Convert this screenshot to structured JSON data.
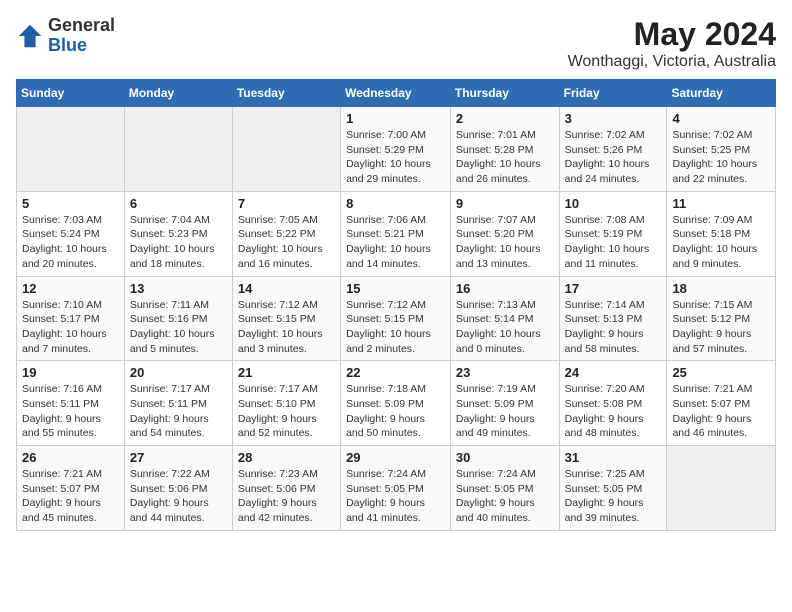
{
  "logo": {
    "general": "General",
    "blue": "Blue"
  },
  "title": "May 2024",
  "subtitle": "Wonthaggi, Victoria, Australia",
  "days_of_week": [
    "Sunday",
    "Monday",
    "Tuesday",
    "Wednesday",
    "Thursday",
    "Friday",
    "Saturday"
  ],
  "weeks": [
    [
      {
        "date": "",
        "sunrise": "",
        "sunset": "",
        "daylight": ""
      },
      {
        "date": "",
        "sunrise": "",
        "sunset": "",
        "daylight": ""
      },
      {
        "date": "",
        "sunrise": "",
        "sunset": "",
        "daylight": ""
      },
      {
        "date": "1",
        "sunrise": "Sunrise: 7:00 AM",
        "sunset": "Sunset: 5:29 PM",
        "daylight": "Daylight: 10 hours and 29 minutes."
      },
      {
        "date": "2",
        "sunrise": "Sunrise: 7:01 AM",
        "sunset": "Sunset: 5:28 PM",
        "daylight": "Daylight: 10 hours and 26 minutes."
      },
      {
        "date": "3",
        "sunrise": "Sunrise: 7:02 AM",
        "sunset": "Sunset: 5:26 PM",
        "daylight": "Daylight: 10 hours and 24 minutes."
      },
      {
        "date": "4",
        "sunrise": "Sunrise: 7:02 AM",
        "sunset": "Sunset: 5:25 PM",
        "daylight": "Daylight: 10 hours and 22 minutes."
      }
    ],
    [
      {
        "date": "5",
        "sunrise": "Sunrise: 7:03 AM",
        "sunset": "Sunset: 5:24 PM",
        "daylight": "Daylight: 10 hours and 20 minutes."
      },
      {
        "date": "6",
        "sunrise": "Sunrise: 7:04 AM",
        "sunset": "Sunset: 5:23 PM",
        "daylight": "Daylight: 10 hours and 18 minutes."
      },
      {
        "date": "7",
        "sunrise": "Sunrise: 7:05 AM",
        "sunset": "Sunset: 5:22 PM",
        "daylight": "Daylight: 10 hours and 16 minutes."
      },
      {
        "date": "8",
        "sunrise": "Sunrise: 7:06 AM",
        "sunset": "Sunset: 5:21 PM",
        "daylight": "Daylight: 10 hours and 14 minutes."
      },
      {
        "date": "9",
        "sunrise": "Sunrise: 7:07 AM",
        "sunset": "Sunset: 5:20 PM",
        "daylight": "Daylight: 10 hours and 13 minutes."
      },
      {
        "date": "10",
        "sunrise": "Sunrise: 7:08 AM",
        "sunset": "Sunset: 5:19 PM",
        "daylight": "Daylight: 10 hours and 11 minutes."
      },
      {
        "date": "11",
        "sunrise": "Sunrise: 7:09 AM",
        "sunset": "Sunset: 5:18 PM",
        "daylight": "Daylight: 10 hours and 9 minutes."
      }
    ],
    [
      {
        "date": "12",
        "sunrise": "Sunrise: 7:10 AM",
        "sunset": "Sunset: 5:17 PM",
        "daylight": "Daylight: 10 hours and 7 minutes."
      },
      {
        "date": "13",
        "sunrise": "Sunrise: 7:11 AM",
        "sunset": "Sunset: 5:16 PM",
        "daylight": "Daylight: 10 hours and 5 minutes."
      },
      {
        "date": "14",
        "sunrise": "Sunrise: 7:12 AM",
        "sunset": "Sunset: 5:15 PM",
        "daylight": "Daylight: 10 hours and 3 minutes."
      },
      {
        "date": "15",
        "sunrise": "Sunrise: 7:12 AM",
        "sunset": "Sunset: 5:15 PM",
        "daylight": "Daylight: 10 hours and 2 minutes."
      },
      {
        "date": "16",
        "sunrise": "Sunrise: 7:13 AM",
        "sunset": "Sunset: 5:14 PM",
        "daylight": "Daylight: 10 hours and 0 minutes."
      },
      {
        "date": "17",
        "sunrise": "Sunrise: 7:14 AM",
        "sunset": "Sunset: 5:13 PM",
        "daylight": "Daylight: 9 hours and 58 minutes."
      },
      {
        "date": "18",
        "sunrise": "Sunrise: 7:15 AM",
        "sunset": "Sunset: 5:12 PM",
        "daylight": "Daylight: 9 hours and 57 minutes."
      }
    ],
    [
      {
        "date": "19",
        "sunrise": "Sunrise: 7:16 AM",
        "sunset": "Sunset: 5:11 PM",
        "daylight": "Daylight: 9 hours and 55 minutes."
      },
      {
        "date": "20",
        "sunrise": "Sunrise: 7:17 AM",
        "sunset": "Sunset: 5:11 PM",
        "daylight": "Daylight: 9 hours and 54 minutes."
      },
      {
        "date": "21",
        "sunrise": "Sunrise: 7:17 AM",
        "sunset": "Sunset: 5:10 PM",
        "daylight": "Daylight: 9 hours and 52 minutes."
      },
      {
        "date": "22",
        "sunrise": "Sunrise: 7:18 AM",
        "sunset": "Sunset: 5:09 PM",
        "daylight": "Daylight: 9 hours and 50 minutes."
      },
      {
        "date": "23",
        "sunrise": "Sunrise: 7:19 AM",
        "sunset": "Sunset: 5:09 PM",
        "daylight": "Daylight: 9 hours and 49 minutes."
      },
      {
        "date": "24",
        "sunrise": "Sunrise: 7:20 AM",
        "sunset": "Sunset: 5:08 PM",
        "daylight": "Daylight: 9 hours and 48 minutes."
      },
      {
        "date": "25",
        "sunrise": "Sunrise: 7:21 AM",
        "sunset": "Sunset: 5:07 PM",
        "daylight": "Daylight: 9 hours and 46 minutes."
      }
    ],
    [
      {
        "date": "26",
        "sunrise": "Sunrise: 7:21 AM",
        "sunset": "Sunset: 5:07 PM",
        "daylight": "Daylight: 9 hours and 45 minutes."
      },
      {
        "date": "27",
        "sunrise": "Sunrise: 7:22 AM",
        "sunset": "Sunset: 5:06 PM",
        "daylight": "Daylight: 9 hours and 44 minutes."
      },
      {
        "date": "28",
        "sunrise": "Sunrise: 7:23 AM",
        "sunset": "Sunset: 5:06 PM",
        "daylight": "Daylight: 9 hours and 42 minutes."
      },
      {
        "date": "29",
        "sunrise": "Sunrise: 7:24 AM",
        "sunset": "Sunset: 5:05 PM",
        "daylight": "Daylight: 9 hours and 41 minutes."
      },
      {
        "date": "30",
        "sunrise": "Sunrise: 7:24 AM",
        "sunset": "Sunset: 5:05 PM",
        "daylight": "Daylight: 9 hours and 40 minutes."
      },
      {
        "date": "31",
        "sunrise": "Sunrise: 7:25 AM",
        "sunset": "Sunset: 5:05 PM",
        "daylight": "Daylight: 9 hours and 39 minutes."
      },
      {
        "date": "",
        "sunrise": "",
        "sunset": "",
        "daylight": ""
      }
    ]
  ]
}
